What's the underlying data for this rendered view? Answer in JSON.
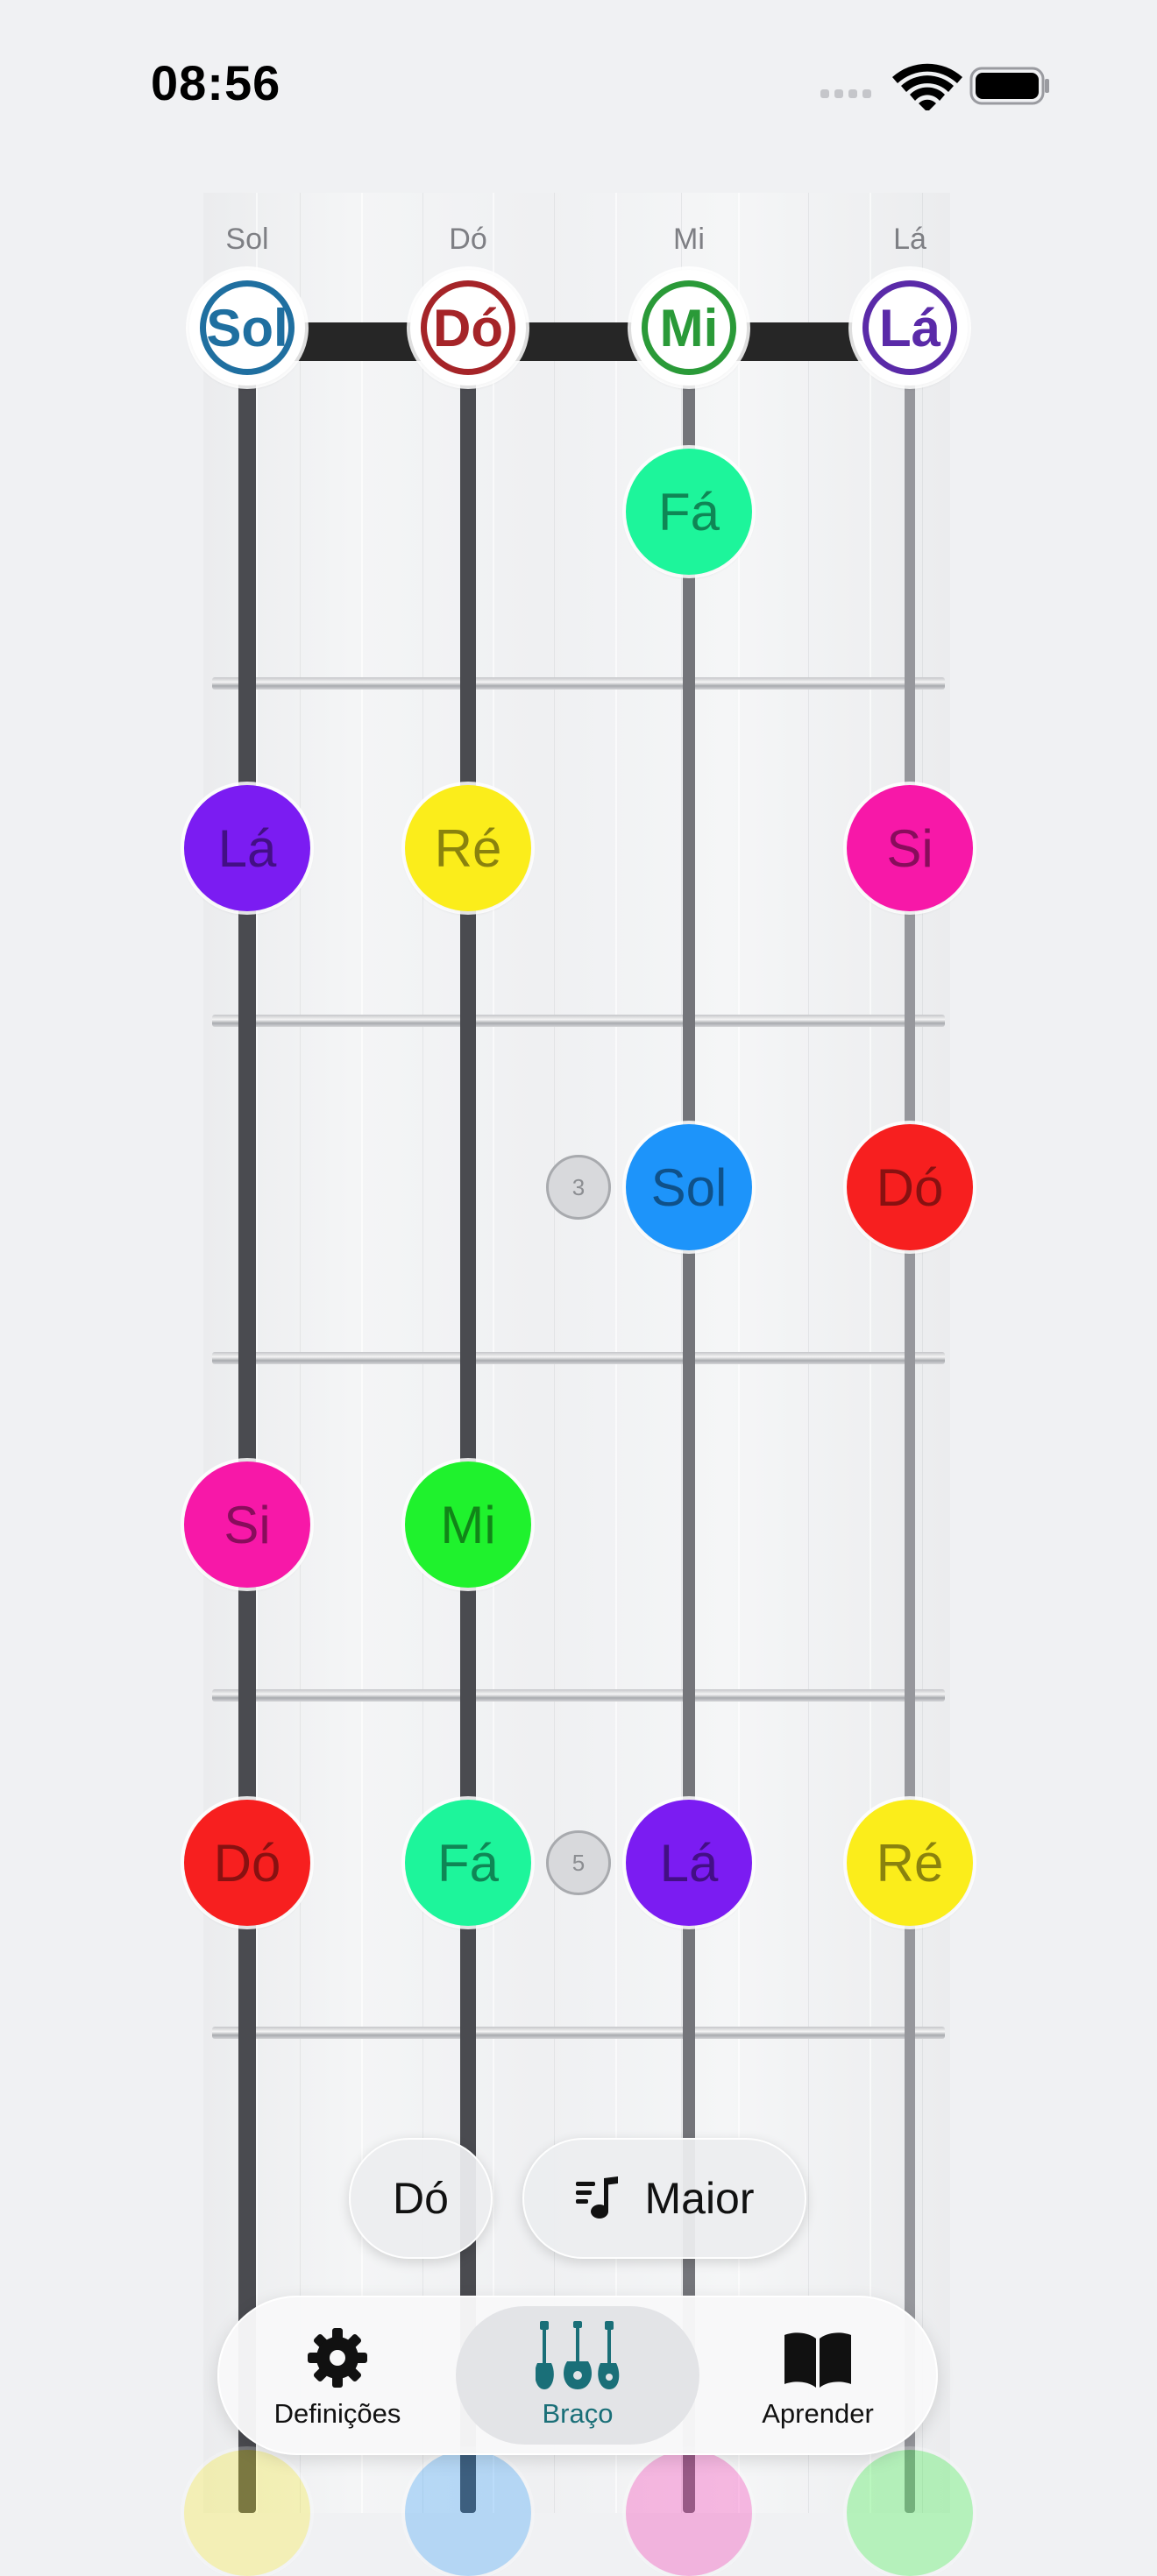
{
  "status_bar": {
    "time": "08:56",
    "icons": [
      "cellular-signal-icon",
      "wifi-icon",
      "battery-icon"
    ]
  },
  "fretboard": {
    "open_strings": [
      {
        "label": "Sol",
        "note": "Sol",
        "color": "#1f6fa0"
      },
      {
        "label": "Dó",
        "note": "Dó",
        "color": "#a52428"
      },
      {
        "label": "Mi",
        "note": "Mi",
        "color": "#2a9a38"
      },
      {
        "label": "Lá",
        "note": "Lá",
        "color": "#5a2aa8"
      }
    ],
    "string_colors": [
      "#4a4b50",
      "#4a4b50",
      "#74757a",
      "#96979c"
    ],
    "frets": [
      {
        "number": 1,
        "notes": [
          {
            "string": 3,
            "name": "Fá",
            "color": "#1df59b"
          }
        ]
      },
      {
        "number": 2,
        "notes": [
          {
            "string": 1,
            "name": "Lá",
            "color": "#7b1cf2"
          },
          {
            "string": 2,
            "name": "Ré",
            "color": "#fbed1b"
          },
          {
            "string": 4,
            "name": "Si",
            "color": "#f718a8"
          }
        ]
      },
      {
        "number": 3,
        "marker": "3",
        "notes": [
          {
            "string": 3,
            "name": "Sol",
            "color": "#1d94fa"
          },
          {
            "string": 4,
            "name": "Dó",
            "color": "#f71f1f"
          }
        ]
      },
      {
        "number": 4,
        "notes": [
          {
            "string": 1,
            "name": "Si",
            "color": "#f718a8"
          },
          {
            "string": 2,
            "name": "Mi",
            "color": "#1ff22d"
          }
        ]
      },
      {
        "number": 5,
        "marker": "5",
        "notes": [
          {
            "string": 1,
            "name": "Dó",
            "color": "#f71f1f"
          },
          {
            "string": 2,
            "name": "Fá",
            "color": "#1df59b"
          },
          {
            "string": 3,
            "name": "Lá",
            "color": "#7b1cf2"
          },
          {
            "string": 4,
            "name": "Ré",
            "color": "#fbed1b"
          }
        ]
      },
      {
        "number": 6,
        "notes": [
          {
            "string": 1,
            "name": "",
            "color": "#fbed1b"
          },
          {
            "string": 2,
            "name": "",
            "color": "#1d94fa"
          },
          {
            "string": 3,
            "name": "",
            "color": "#f718a8"
          },
          {
            "string": 4,
            "name": "",
            "color": "#1ff22d"
          }
        ]
      }
    ]
  },
  "controls": {
    "root_note": "Dó",
    "scale": {
      "label": "Maior",
      "icon": "music-note-list-icon"
    }
  },
  "tab_bar": {
    "selected": "Braço",
    "accent_color": "#1a6f78",
    "tabs": [
      {
        "label": "Definições",
        "icon": "gear-icon"
      },
      {
        "label": "Braço",
        "icon": "ukulele-icon"
      },
      {
        "label": "Aprender",
        "icon": "book-icon"
      }
    ]
  }
}
